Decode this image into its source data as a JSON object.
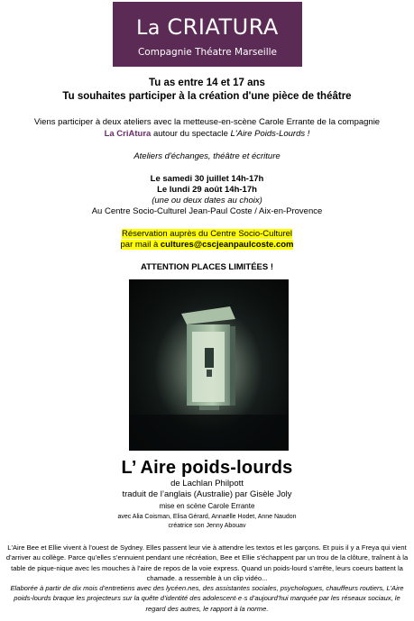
{
  "logo": {
    "la": "La ",
    "name": "CRIATURA",
    "subtitle": "Compagnie Théatre Marseille",
    "bg_color": "#5b2a55"
  },
  "header": {
    "line1": "Tu as entre 14 et 17 ans",
    "line2": "Tu souhaites participer à la création d'une pièce de théâtre"
  },
  "intro": {
    "line1": "Viens participer à deux ateliers avec la metteuse-en-scène Carole Errante de la compagnie",
    "company": "La CriAtura",
    "line2_middle": " autour du spectacle ",
    "show": "L'Aire Poids-Lourds !"
  },
  "workshop_type": "Ateliers d'échanges, théâtre et écriture",
  "dates": {
    "date1": "Le samedi 30 juillet 14h-17h",
    "date2": "Le lundi 29 août 14h-17h",
    "choice": "(une ou deux dates au choix)",
    "place": "Au Centre Socio-Culturel Jean-Paul Coste / Aix-en-Provence"
  },
  "reservation": {
    "line1": "Réservation auprès du Centre Socio-Culturel",
    "mail_prefix": "par mail à ",
    "email": "cultures@cscjeanpaulcoste.com"
  },
  "attention": "ATTENTION PLACES LIMITÉES !",
  "show": {
    "title": "L’ Aire poids-lourds",
    "author": "de Lachlan Philpott",
    "translation": "traduit de l’anglais (Australie) par Gisèle Joly",
    "direction": "mise en scène Carole Errante",
    "cast": "avec Alia Coisman, Elisa Gérard, Annaëlle Hodet, Anne Naudon",
    "sound": "créatrice son Jenny Abouav"
  },
  "synopsis": {
    "p1": "L'Aire Bee et Ellie vivent à l’ouest de Sydney. Elles passent leur vie à attendre les textos et les garçons. Et puis il y a Freya qui vient d’arriver au collège. Parce qu’elles s’ennuient pendant une récréation, Bee et Ellie s’échappent par un trou de la clôture, traînent à la table de pique-nique avec les mouches à l’aire de repos de la voie express. Quand un poids-lourd s’arrête, leurs coeurs battent la chamade. a ressemble à un clip vidéo...",
    "p2": "Elaborée à partir de dix mois d’entretiens avec des lycéen.nes, des assistantes sociales, psychologues, chauffeurs routiers, L’Aire poids-lourds braque les projecteurs sur la quête d’identité des adolescent·e·s d’aujourd’hui marquée par les réseaux sociaux, le regard des autres, le rapport à la norme."
  }
}
